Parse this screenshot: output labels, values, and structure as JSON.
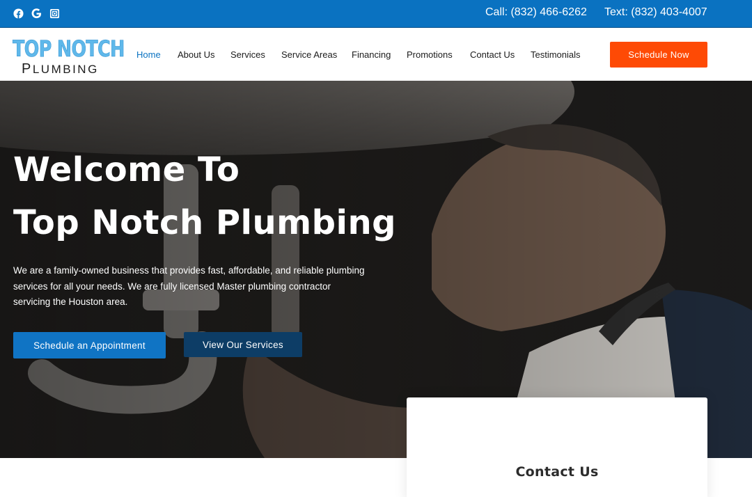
{
  "topbar": {
    "social": [
      {
        "icon": "facebook-icon"
      },
      {
        "icon": "google-icon"
      },
      {
        "icon": "instagram-icon"
      }
    ],
    "call": "Call: (832) 466-6262",
    "text": "Text: (832) 403-4007"
  },
  "logo": {
    "top": "TOP NOTCH",
    "bottom_first": "P",
    "bottom_rest": "LUMBING"
  },
  "nav": {
    "items": [
      "Home",
      "About Us",
      "Services",
      "Service Areas",
      "Financing",
      "Promotions",
      "Contact Us",
      "Testimonials"
    ],
    "active": "Home",
    "cta": "Schedule Now"
  },
  "hero": {
    "title_line1": "Welcome To",
    "title_line2": "Top Notch Plumbing",
    "description": "We are a family-owned business that provides fast, affordable, and reliable plumbing services for all your needs. We are fully licensed Master plumbing contractor servicing the Houston area.",
    "primary_button": "Schedule an Appointment",
    "secondary_button": "View Our Services"
  },
  "contact_card": {
    "title": "Contact Us"
  },
  "colors": {
    "topbar": "#0a72c1",
    "accent_orange": "#fe4a05",
    "primary_blue": "#1074c4",
    "dark_blue": "#0d3d66",
    "logo_blue": "#5fb8ea"
  }
}
